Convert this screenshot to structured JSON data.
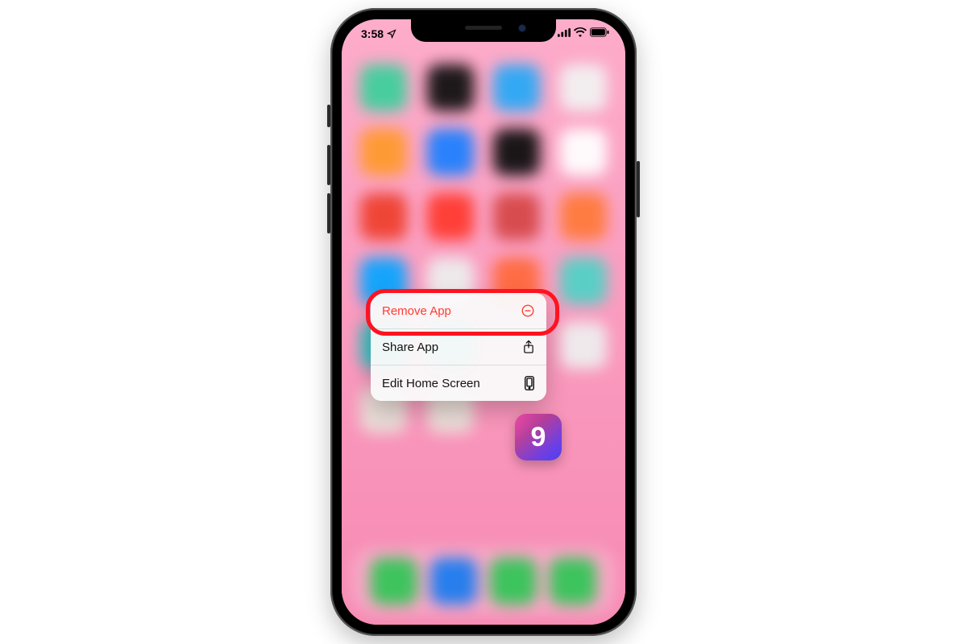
{
  "status": {
    "time": "3:58"
  },
  "focused_app": {
    "glyph": "9"
  },
  "menu": {
    "items": [
      {
        "label": "Remove App",
        "icon": "minus-circle-icon",
        "danger": true
      },
      {
        "label": "Share App",
        "icon": "share-icon",
        "danger": false
      },
      {
        "label": "Edit Home Screen",
        "icon": "phone-device-icon",
        "danger": false
      }
    ]
  },
  "highlight_index": 0
}
